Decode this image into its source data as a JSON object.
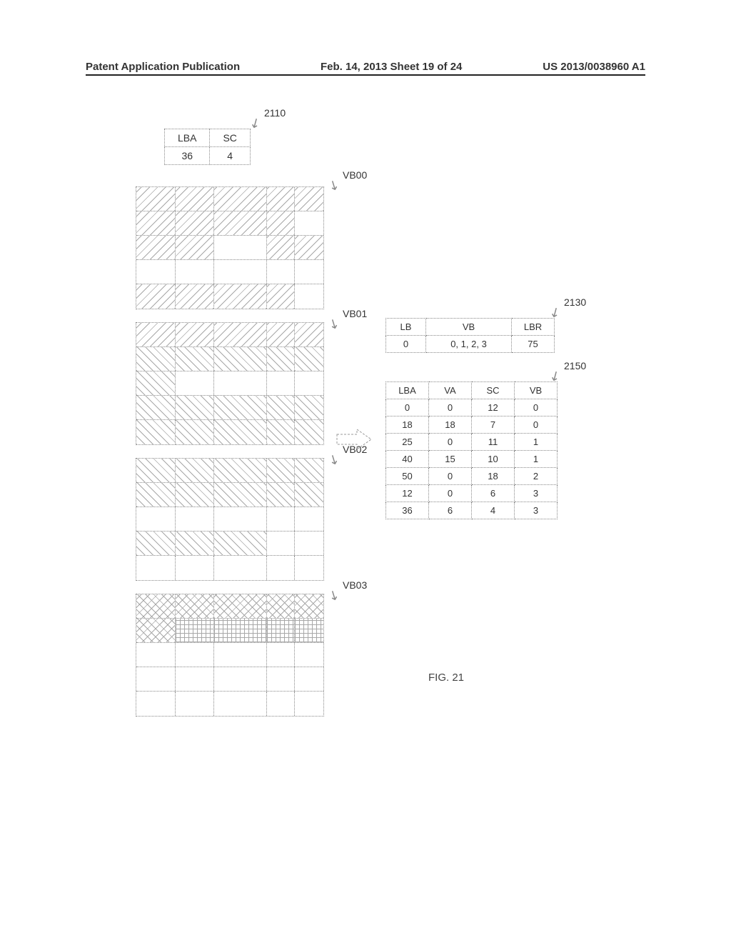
{
  "header": {
    "left": "Patent Application Publication",
    "mid": "Feb. 14, 2013  Sheet 19 of 24",
    "right": "US 2013/0038960 A1"
  },
  "refs": {
    "r2110": "2110",
    "r2130": "2130",
    "r2150": "2150"
  },
  "table_2110": {
    "h0": "LBA",
    "h1": "SC",
    "v0": "36",
    "v1": "4"
  },
  "vblocks": {
    "labels": [
      "VB00",
      "VB01",
      "VB02",
      "VB03"
    ]
  },
  "table_2130": {
    "headers": [
      "LB",
      "VB",
      "LBR"
    ],
    "rows": [
      [
        "0",
        "0, 1, 2, 3",
        "75"
      ]
    ]
  },
  "table_2150": {
    "headers": [
      "LBA",
      "VA",
      "SC",
      "VB"
    ],
    "rows": [
      [
        "0",
        "0",
        "12",
        "0"
      ],
      [
        "18",
        "18",
        "7",
        "0"
      ],
      [
        "25",
        "0",
        "11",
        "1"
      ],
      [
        "40",
        "15",
        "10",
        "1"
      ],
      [
        "50",
        "0",
        "18",
        "2"
      ],
      [
        "12",
        "0",
        "6",
        "3"
      ],
      [
        "36",
        "6",
        "4",
        "3"
      ]
    ]
  },
  "fig": "FIG. 21"
}
